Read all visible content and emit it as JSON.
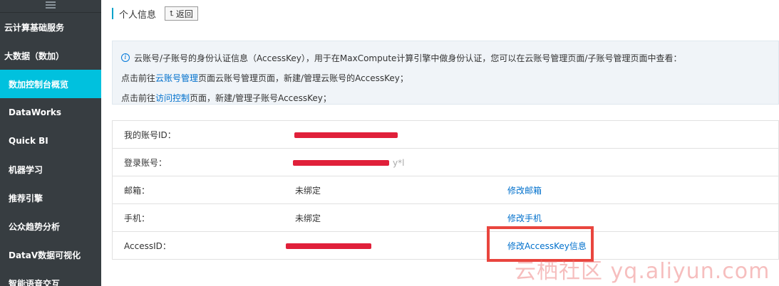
{
  "sidebar": {
    "items": [
      {
        "label": "云计算基础服务",
        "active": false,
        "sub": false
      },
      {
        "label": "大数据（数加）",
        "active": false,
        "sub": false
      },
      {
        "label": "数加控制台概览",
        "active": true,
        "sub": true
      },
      {
        "label": "DataWorks",
        "active": false,
        "sub": true
      },
      {
        "label": "Quick BI",
        "active": false,
        "sub": true
      },
      {
        "label": "机器学习",
        "active": false,
        "sub": true
      },
      {
        "label": "推荐引擎",
        "active": false,
        "sub": true
      },
      {
        "label": "公众趋势分析",
        "active": false,
        "sub": true
      },
      {
        "label": "DataV数据可视化",
        "active": false,
        "sub": true
      },
      {
        "label": "智能语音交互",
        "active": false,
        "sub": true
      }
    ]
  },
  "header": {
    "title": "个人信息",
    "back_label": "返回"
  },
  "info": {
    "line1": "云账号/子账号的身份认证信息（AccessKey），用于在MaxCompute计算引擎中做身份认证，您可以在云账号管理页面/子账号管理页面中查看：",
    "line2_prefix": "点击前往",
    "line2_link": "云账号管理",
    "line2_suffix": "页面云账号管理页面，新建/管理云账号的AccessKey；",
    "line3_prefix": "点击前往",
    "line3_link": "访问控制",
    "line3_suffix": "页面，新建/管理子账号AccessKey；"
  },
  "table": {
    "rows": [
      {
        "label": "我的账号ID：",
        "value": "",
        "action": ""
      },
      {
        "label": "登录账号：",
        "value": "y*l",
        "action": ""
      },
      {
        "label": "邮箱：",
        "value": "未绑定",
        "action": "修改邮箱"
      },
      {
        "label": "手机：",
        "value": "未绑定",
        "action": "修改手机"
      },
      {
        "label": "AccessID：",
        "value": "",
        "action": "修改AccessKey信息"
      }
    ]
  },
  "watermark": "云栖社区 yq.aliyun.com",
  "colors": {
    "sidebar_bg": "#373d41",
    "active_bg": "#00c1de",
    "link": "#0070cc",
    "highlight": "#e9453e"
  }
}
